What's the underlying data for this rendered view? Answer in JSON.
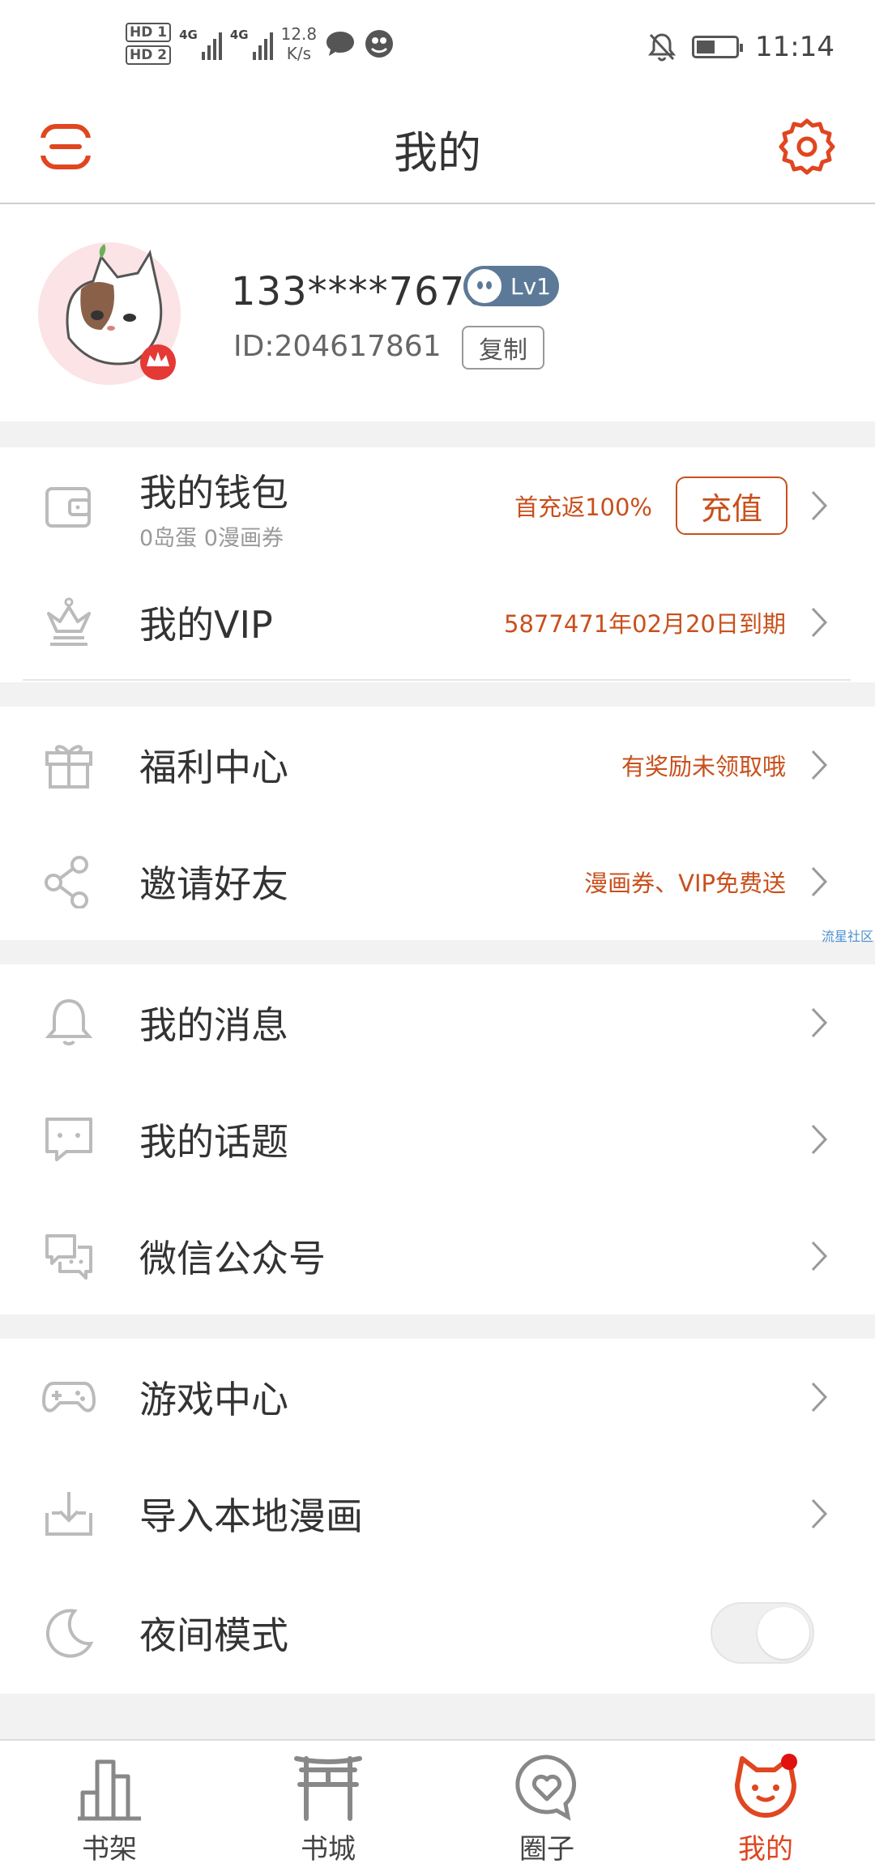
{
  "status_bar": {
    "hd1": "HD 1",
    "hd2": "HD 2",
    "net1": "4G",
    "net2": "4G",
    "speed_value": "12.8",
    "speed_unit": "K/s",
    "time": "11:14"
  },
  "header": {
    "title": "我的"
  },
  "profile": {
    "username": "133****7676",
    "level": "Lv1",
    "id": "ID:204617861",
    "copy_label": "复制"
  },
  "wallet_group": {
    "wallet": {
      "label": "我的钱包",
      "sub": "0岛蛋 0漫画券",
      "hint": "首充返100%",
      "button": "充值"
    },
    "vip": {
      "label": "我的VIP",
      "hint": "5877471年02月20日到期"
    }
  },
  "benefit_group": {
    "welfare": {
      "label": "福利中心",
      "hint": "有奖励未领取哦"
    },
    "invite": {
      "label": "邀请好友",
      "hint": "漫画券、VIP免费送"
    }
  },
  "social_group": {
    "messages": {
      "label": "我的消息"
    },
    "topics": {
      "label": "我的话题"
    },
    "wechat": {
      "label": "微信公众号"
    }
  },
  "tools_group": {
    "games": {
      "label": "游戏中心"
    },
    "import": {
      "label": "导入本地漫画"
    },
    "night": {
      "label": "夜间模式",
      "enabled": false
    }
  },
  "watermark": "流星社区",
  "tabs": [
    {
      "label": "书架",
      "active": false
    },
    {
      "label": "书城",
      "active": false
    },
    {
      "label": "圈子",
      "active": false
    },
    {
      "label": "我的",
      "active": true
    }
  ],
  "colors": {
    "accent": "#e0461f",
    "hint": "#c8501c",
    "level_badge": "#5c7a98"
  }
}
